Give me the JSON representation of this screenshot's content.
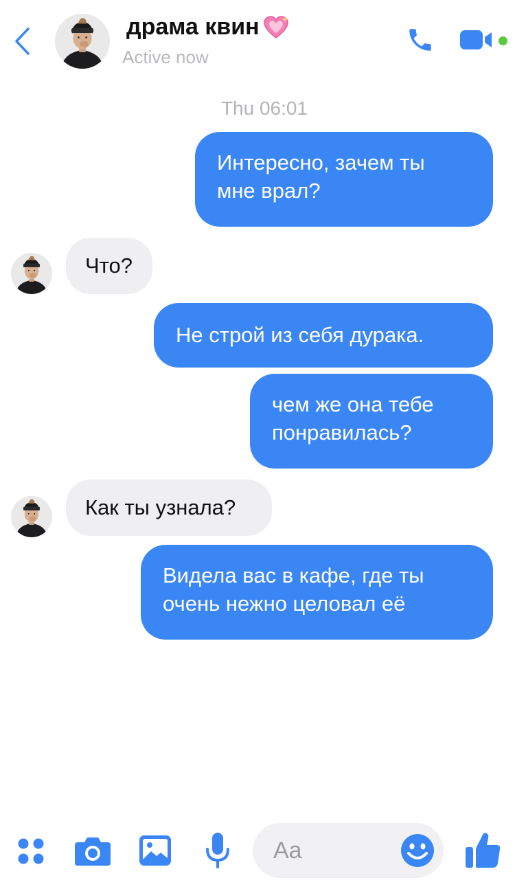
{
  "header": {
    "back_icon": "chevron-left-icon",
    "contact_name": "драма квин",
    "name_emoji": "sparkling-heart-icon",
    "status": "Active now",
    "call_icon": "phone-icon",
    "video_icon": "video-camera-icon",
    "online_color": "#5ac93f"
  },
  "conversation": {
    "timestamp": "Thu 06:01",
    "messages": [
      {
        "direction": "outgoing",
        "lines": [
          "Интересно, зачем ты",
          "мне врал?"
        ]
      },
      {
        "direction": "incoming",
        "lines": [
          "Что?"
        ]
      },
      {
        "direction": "outgoing",
        "lines": [
          "Не строй из себя дурака."
        ]
      },
      {
        "direction": "outgoing",
        "lines": [
          "чем же она тебе",
          "понравилась?"
        ]
      },
      {
        "direction": "incoming",
        "lines": [
          "Как ты узнала?"
        ]
      },
      {
        "direction": "outgoing",
        "lines": [
          "Видела вас в кафе, где ты",
          "очень нежно целовал её"
        ]
      }
    ]
  },
  "composer": {
    "placeholder": "Aa",
    "menu_icon": "four-dots-menu-icon",
    "camera_icon": "camera-icon",
    "gallery_icon": "image-icon",
    "mic_icon": "microphone-icon",
    "emoji_icon": "smiley-icon",
    "like_icon": "thumbs-up-icon"
  },
  "colors": {
    "accent": "#3a86f5",
    "incoming_bubble": "#efeff2",
    "muted_text": "#b8b8bd"
  }
}
